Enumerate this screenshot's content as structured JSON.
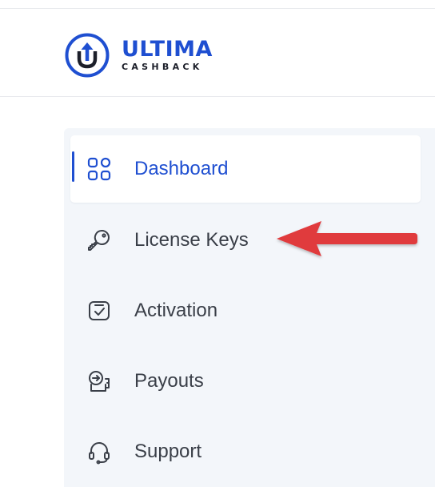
{
  "brand": {
    "name": "ULTIMA",
    "tagline": "CASHBACK",
    "color": "#1f4fd1"
  },
  "sidebar": {
    "items": [
      {
        "label": "Dashboard",
        "icon": "grid-icon",
        "active": true
      },
      {
        "label": "License Keys",
        "icon": "key-icon",
        "active": false
      },
      {
        "label": "Activation",
        "icon": "monitor-check-icon",
        "active": false
      },
      {
        "label": "Payouts",
        "icon": "wallet-arrow-icon",
        "active": false
      },
      {
        "label": "Support",
        "icon": "headset-icon",
        "active": false
      }
    ]
  },
  "annotation": {
    "type": "arrow",
    "color": "#e03a3e",
    "points_to": "License Keys"
  }
}
